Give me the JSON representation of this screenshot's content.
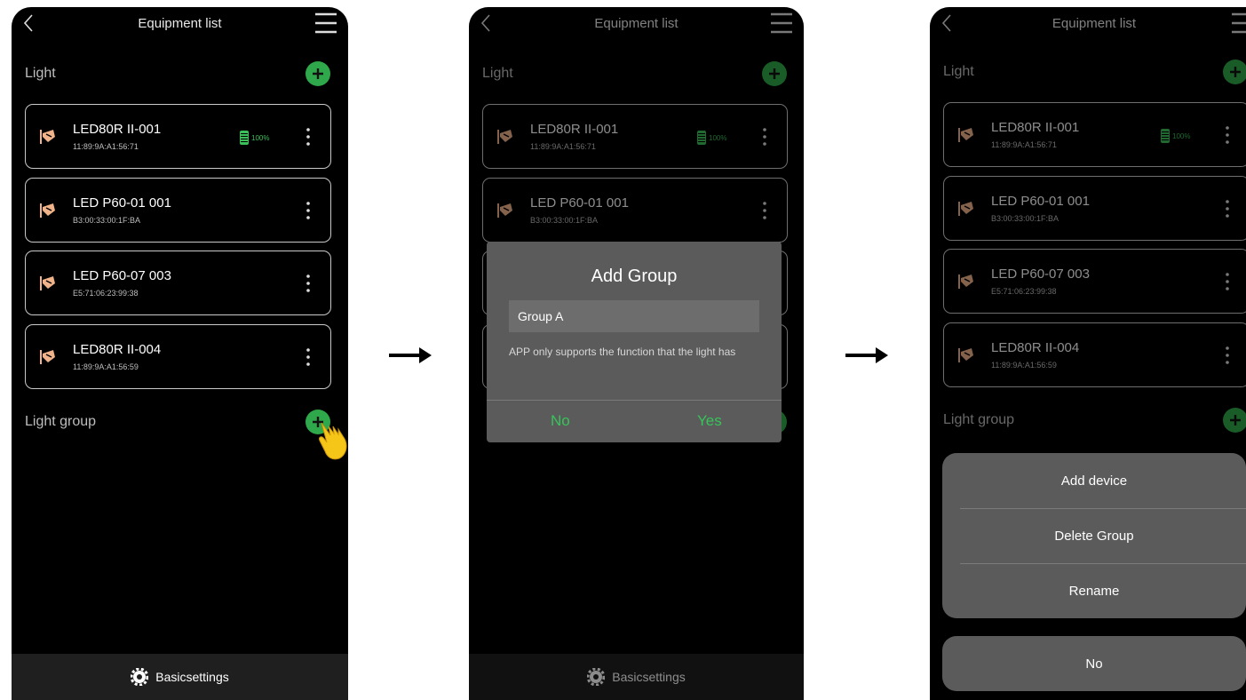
{
  "header": {
    "title": "Equipment list"
  },
  "sections": {
    "light": "Light",
    "light_group": "Light group"
  },
  "devices": [
    {
      "name": "LED80R II-001",
      "mac": "11:89:9A:A1:56:71",
      "battery": "100%"
    },
    {
      "name": "LED P60-01 001",
      "mac": "B3:00:33:00:1F:BA",
      "battery": ""
    },
    {
      "name": "LED P60-07 003",
      "mac": "E5:71:06:23:99:38",
      "battery": ""
    },
    {
      "name": "LED80R II-004",
      "mac": "11:89:9A:A1:56:59",
      "battery": ""
    }
  ],
  "footer": {
    "label": "Basicsettings"
  },
  "dialog": {
    "title": "Add Group",
    "input_value": "Group A",
    "note": "APP only supports the function that the light has",
    "no": "No",
    "yes": "Yes"
  },
  "sheet": {
    "items": [
      "Add device",
      "Delete Group",
      "Rename"
    ],
    "cancel": "No"
  },
  "colors": {
    "accent": "#2ea84a",
    "dialog_bg": "#5b5b5b",
    "lamp": "#f0b38a"
  },
  "icons": [
    "back-icon",
    "menu-icon",
    "plus-icon",
    "lamp-icon",
    "battery-icon",
    "more-icon",
    "gear-icon",
    "hand-icon",
    "arrow-right-icon"
  ]
}
